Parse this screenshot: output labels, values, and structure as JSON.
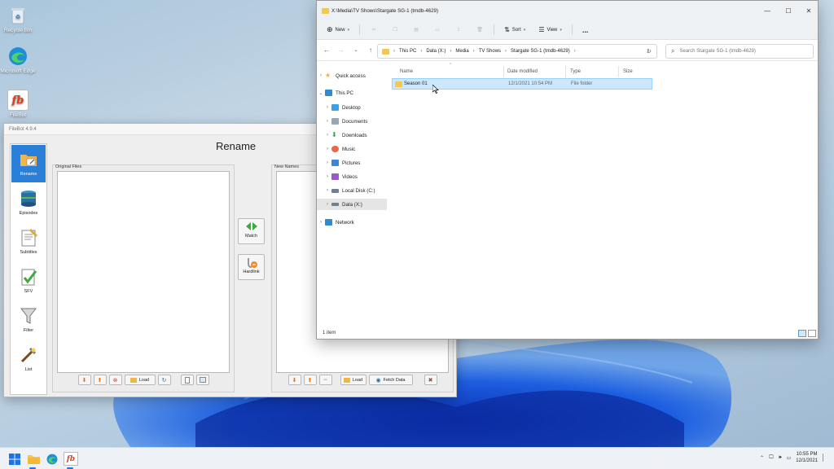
{
  "desktop": {
    "icons": [
      {
        "label": "Recycle Bin",
        "icon": "recycle-bin-icon"
      },
      {
        "label": "Microsoft Edge",
        "icon": "edge-icon"
      },
      {
        "label": "FileBot",
        "icon": "filebot-icon"
      }
    ]
  },
  "filebot": {
    "window_title": "FileBot 4.9.4",
    "header": "Rename",
    "sidebar": [
      {
        "label": "Rename",
        "icon": "rename-icon",
        "active": true
      },
      {
        "label": "Episodes",
        "icon": "episodes-icon"
      },
      {
        "label": "Subtitles",
        "icon": "subtitles-icon"
      },
      {
        "label": "SFV",
        "icon": "sfv-icon"
      },
      {
        "label": "Filter",
        "icon": "filter-icon"
      },
      {
        "label": "List",
        "icon": "list-icon"
      }
    ],
    "original_files": {
      "caption": "Original Files",
      "load_label": "Load"
    },
    "new_names": {
      "caption": "New Names",
      "load_label": "Load",
      "fetch_label": "Fetch Data"
    },
    "match_label": "Match",
    "hardlink_label": "Hardlink",
    "accent": "#2a7fd8"
  },
  "explorer": {
    "title": "X:\\Media\\TV Shows\\Stargate SG-1 (tmdb-4629)",
    "toolbar": {
      "new_label": "New",
      "sort_label": "Sort",
      "view_label": "View",
      "more_label": "..."
    },
    "breadcrumb": [
      "This PC",
      "Data (X:)",
      "Media",
      "TV Shows",
      "Stargate SG-1 (tmdb-4629)"
    ],
    "search_placeholder": "Search Stargate SG-1 (tmdb-4629)",
    "nav": {
      "quick_access": "Quick access",
      "this_pc": "This PC",
      "desktop": "Desktop",
      "documents": "Documents",
      "downloads": "Downloads",
      "music": "Music",
      "pictures": "Pictures",
      "videos": "Videos",
      "local_disk": "Local Disk (C:)",
      "data_drive": "Data (X:)",
      "network": "Network"
    },
    "columns": {
      "name": "Name",
      "date": "Date modified",
      "type": "Type",
      "size": "Size"
    },
    "rows": [
      {
        "name": "Season 01",
        "date": "12/1/2021 10:54 PM",
        "type": "File folder",
        "size": ""
      }
    ],
    "status": "1 item",
    "selection_color": "#cce8ff"
  },
  "taskbar": {
    "time": "10:55 PM",
    "date": "12/1/2021"
  }
}
